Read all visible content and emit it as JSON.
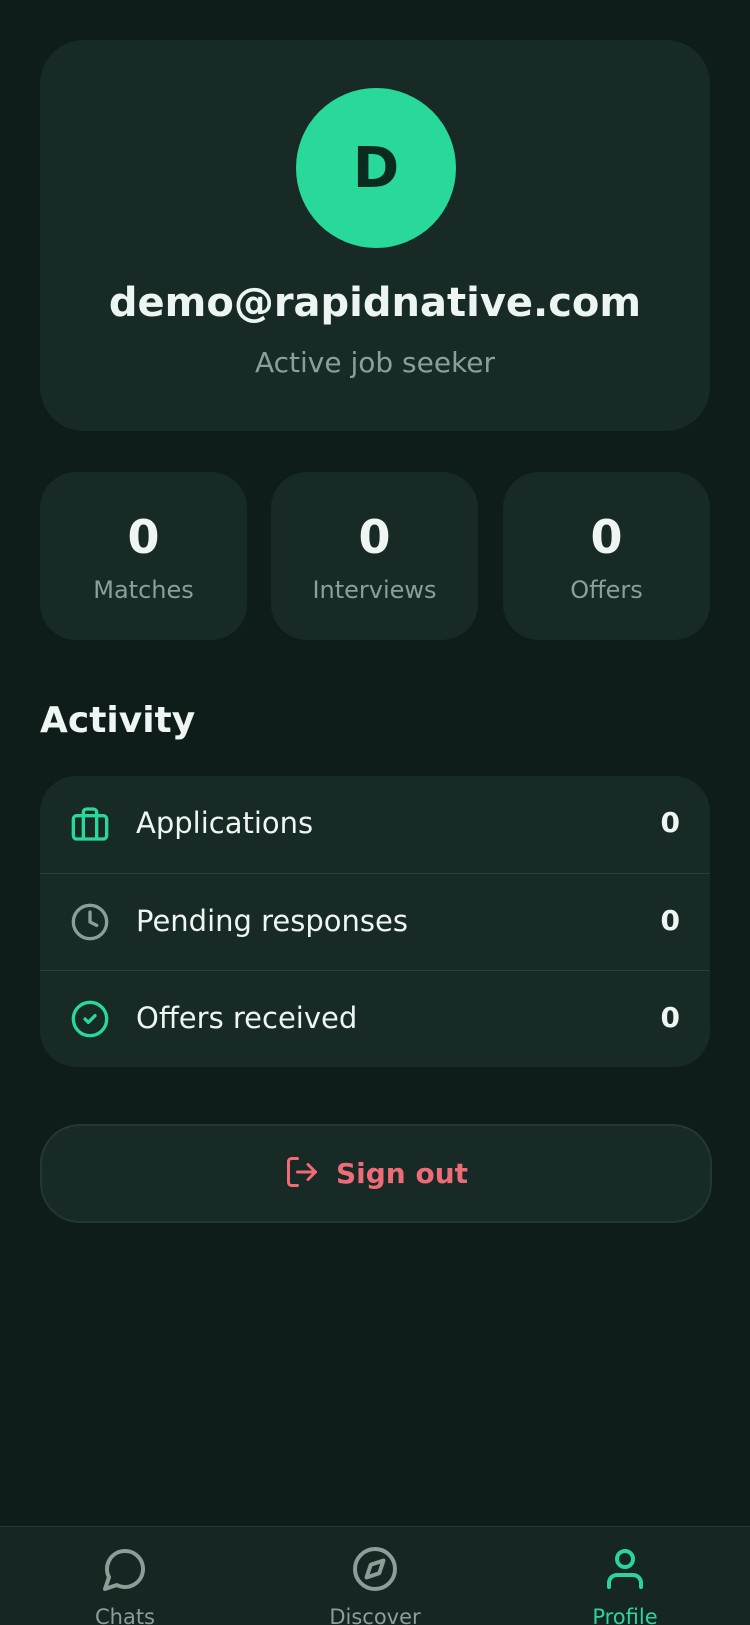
{
  "profile": {
    "avatar_initial": "D",
    "email": "demo@rapidnative.com",
    "status": "Active job seeker"
  },
  "stats": [
    {
      "value": "0",
      "label": "Matches"
    },
    {
      "value": "0",
      "label": "Interviews"
    },
    {
      "value": "0",
      "label": "Offers"
    }
  ],
  "activity": {
    "title": "Activity",
    "rows": [
      {
        "label": "Applications",
        "count": "0",
        "icon": "briefcase-icon"
      },
      {
        "label": "Pending responses",
        "count": "0",
        "icon": "clock-icon"
      },
      {
        "label": "Offers received",
        "count": "0",
        "icon": "check-circle-icon"
      }
    ]
  },
  "signout": {
    "label": "Sign out",
    "icon": "logout-icon"
  },
  "tabs": [
    {
      "label": "Chats",
      "icon": "chat-icon",
      "active": false
    },
    {
      "label": "Discover",
      "icon": "compass-icon",
      "active": false
    },
    {
      "label": "Profile",
      "icon": "user-icon",
      "active": true
    }
  ],
  "colors": {
    "background": "#0e1c1a",
    "card": "#172a26",
    "accent": "#29d99a",
    "danger": "#ee6b77",
    "muted": "#8d9e99"
  }
}
